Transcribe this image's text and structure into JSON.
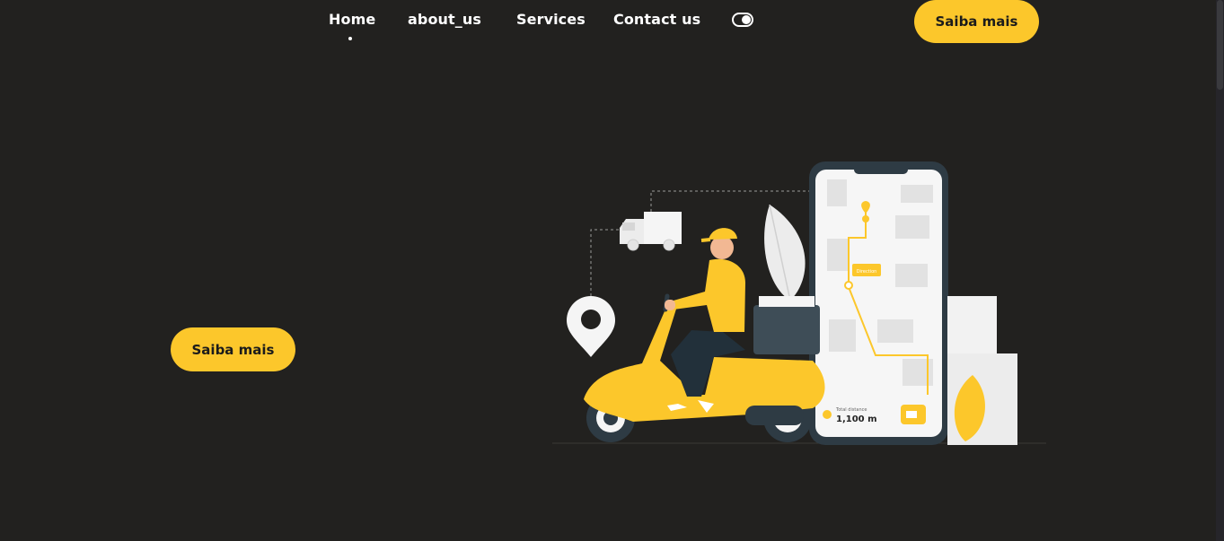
{
  "nav": {
    "items": [
      {
        "label": "Home"
      },
      {
        "label": "about_us"
      },
      {
        "label": "Services"
      },
      {
        "label": "Contact us"
      }
    ],
    "cta": "Saiba mais"
  },
  "hero": {
    "cta": "Saiba mais",
    "illustration": {
      "map_tag": "Direction",
      "distance_label": "Total distance",
      "distance_value": "1,100 m"
    }
  },
  "colors": {
    "background": "#22211f",
    "accent": "#fcc72b",
    "text": "#ffffff"
  }
}
